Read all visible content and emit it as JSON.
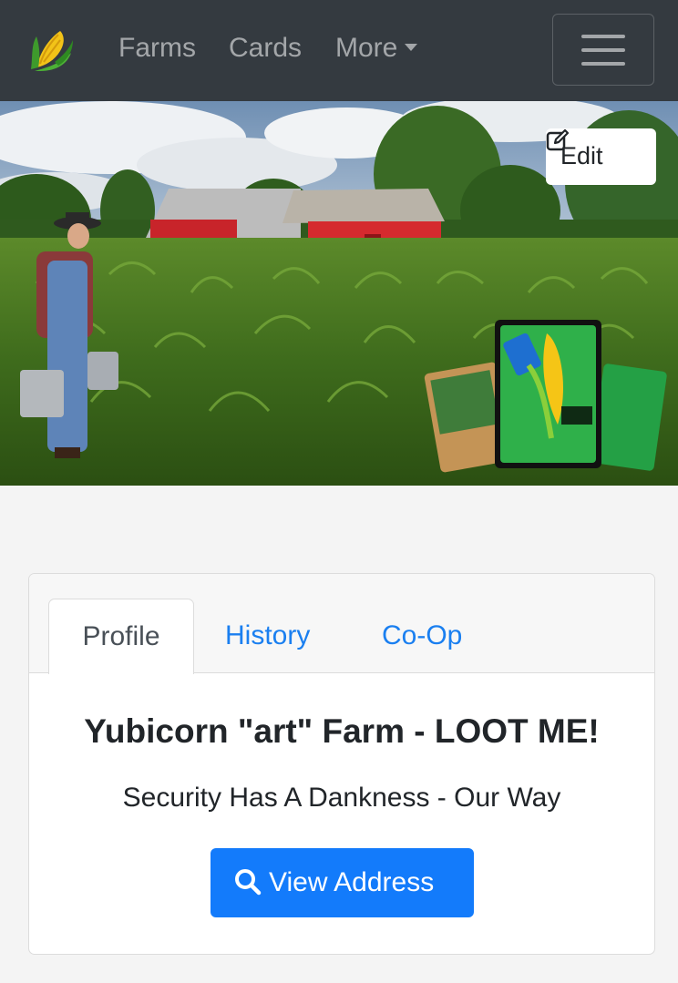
{
  "nav": {
    "brand_icon": "corn-icon",
    "links": [
      "Farms",
      "Cards",
      "More"
    ],
    "menu_icon": "hamburger-icon"
  },
  "banner": {
    "description_icon": "farm-banner-image",
    "edit_label": "Edit",
    "edit_icon": "edit-icon"
  },
  "tabs": [
    "Profile",
    "History",
    "Co-Op"
  ],
  "active_tab": "Profile",
  "profile": {
    "title": "Yubicorn \"art\" Farm - LOOT ME!",
    "subtitle": "Security Has A Dankness - Our Way",
    "button_label": "View Address",
    "button_icon": "search-icon"
  },
  "colors": {
    "navbar": "#343a40",
    "primary": "#137bfb",
    "link": "#1a7ff0"
  }
}
